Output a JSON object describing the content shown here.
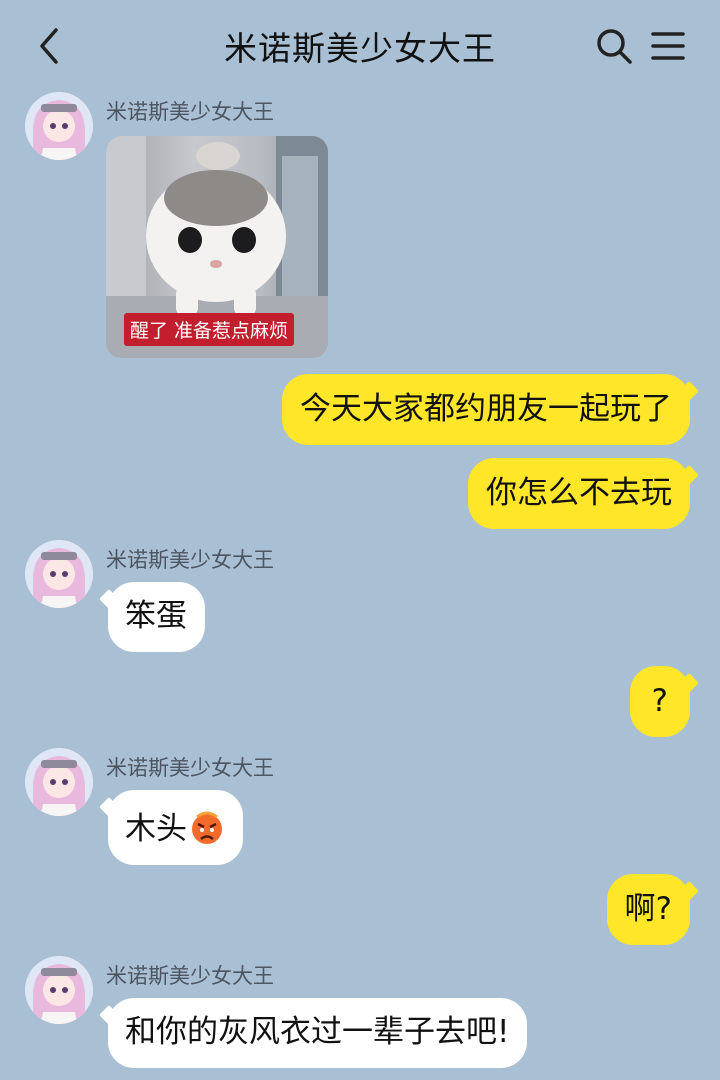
{
  "header": {
    "title": "米诺斯美少女大王",
    "back_icon": "chevron-left-icon",
    "search_icon": "search-icon",
    "menu_icon": "menu-icon"
  },
  "colors": {
    "background": "#a9bfd3",
    "incoming_bubble": "#ffffff",
    "outgoing_bubble": "#ffe629",
    "caption_bg": "#c21e2d"
  },
  "messages": [
    {
      "direction": "in",
      "sender": "米诺斯美少女大王",
      "type": "image",
      "caption": "醒了 准备惹点麻烦"
    },
    {
      "direction": "out",
      "type": "text",
      "text": "今天大家都约朋友一起玩了"
    },
    {
      "direction": "out",
      "type": "text",
      "text": "你怎么不去玩"
    },
    {
      "direction": "in",
      "sender": "米诺斯美少女大王",
      "type": "text",
      "text": "笨蛋"
    },
    {
      "direction": "out",
      "type": "text",
      "text": "?"
    },
    {
      "direction": "in",
      "sender": "米诺斯美少女大王",
      "type": "text",
      "text": "木头",
      "emoji": "angry-face-emoji"
    },
    {
      "direction": "out",
      "type": "text",
      "text": "啊?"
    },
    {
      "direction": "in",
      "sender": "米诺斯美少女大王",
      "type": "text",
      "text": "和你的灰风衣过一辈子去吧!"
    }
  ]
}
